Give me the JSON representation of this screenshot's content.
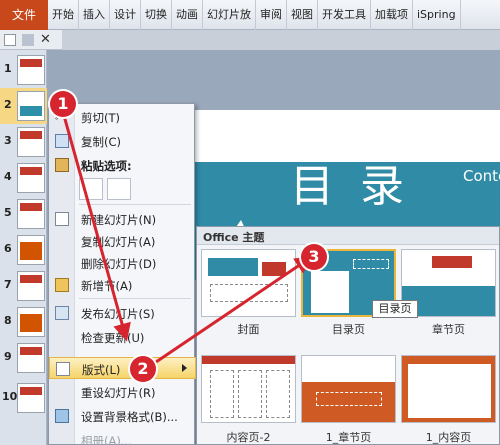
{
  "ribbon": {
    "file_tab": "文件",
    "tabs": [
      "开始",
      "插入",
      "设计",
      "切换",
      "动画",
      "幻灯片放",
      "审阅",
      "视图",
      "开发工具",
      "加载项",
      "iSpring"
    ]
  },
  "thumbnails": {
    "numbers": [
      "1",
      "2",
      "3",
      "4",
      "5",
      "6",
      "7",
      "8",
      "9",
      "10"
    ],
    "selected": "2"
  },
  "slide": {
    "title": "目 录",
    "subtitle": "Conte"
  },
  "context_menu": {
    "cut": "剪切(T)",
    "copy": "复制(C)",
    "paste_options": "粘贴选项:",
    "new_slide": "新建幻灯片(N)",
    "duplicate_slide": "复制幻灯片(A)",
    "delete_slide": "删除幻灯片(D)",
    "new_section": "新增节(A)",
    "publish_slides": "发布幻灯片(S)",
    "check_updates": "检查更新(U)",
    "layout": "版式(L)",
    "reset_slide": "重设幻灯片(R)",
    "format_background": "设置背景格式(B)...",
    "photo_album": "相册(A)..."
  },
  "gallery": {
    "header": "Office 主题",
    "layouts": [
      "封面",
      "目录页",
      "章节页",
      "内容页-2",
      "1_章节页",
      "1_内容页"
    ],
    "selected": "目录页"
  },
  "tooltip": "目录页",
  "badges": [
    "1",
    "2",
    "3"
  ],
  "colors": {
    "accent_red": "#d6252e",
    "teal": "#2f8ba6",
    "orange": "#d05a24",
    "file_tab": "#c8471b"
  }
}
